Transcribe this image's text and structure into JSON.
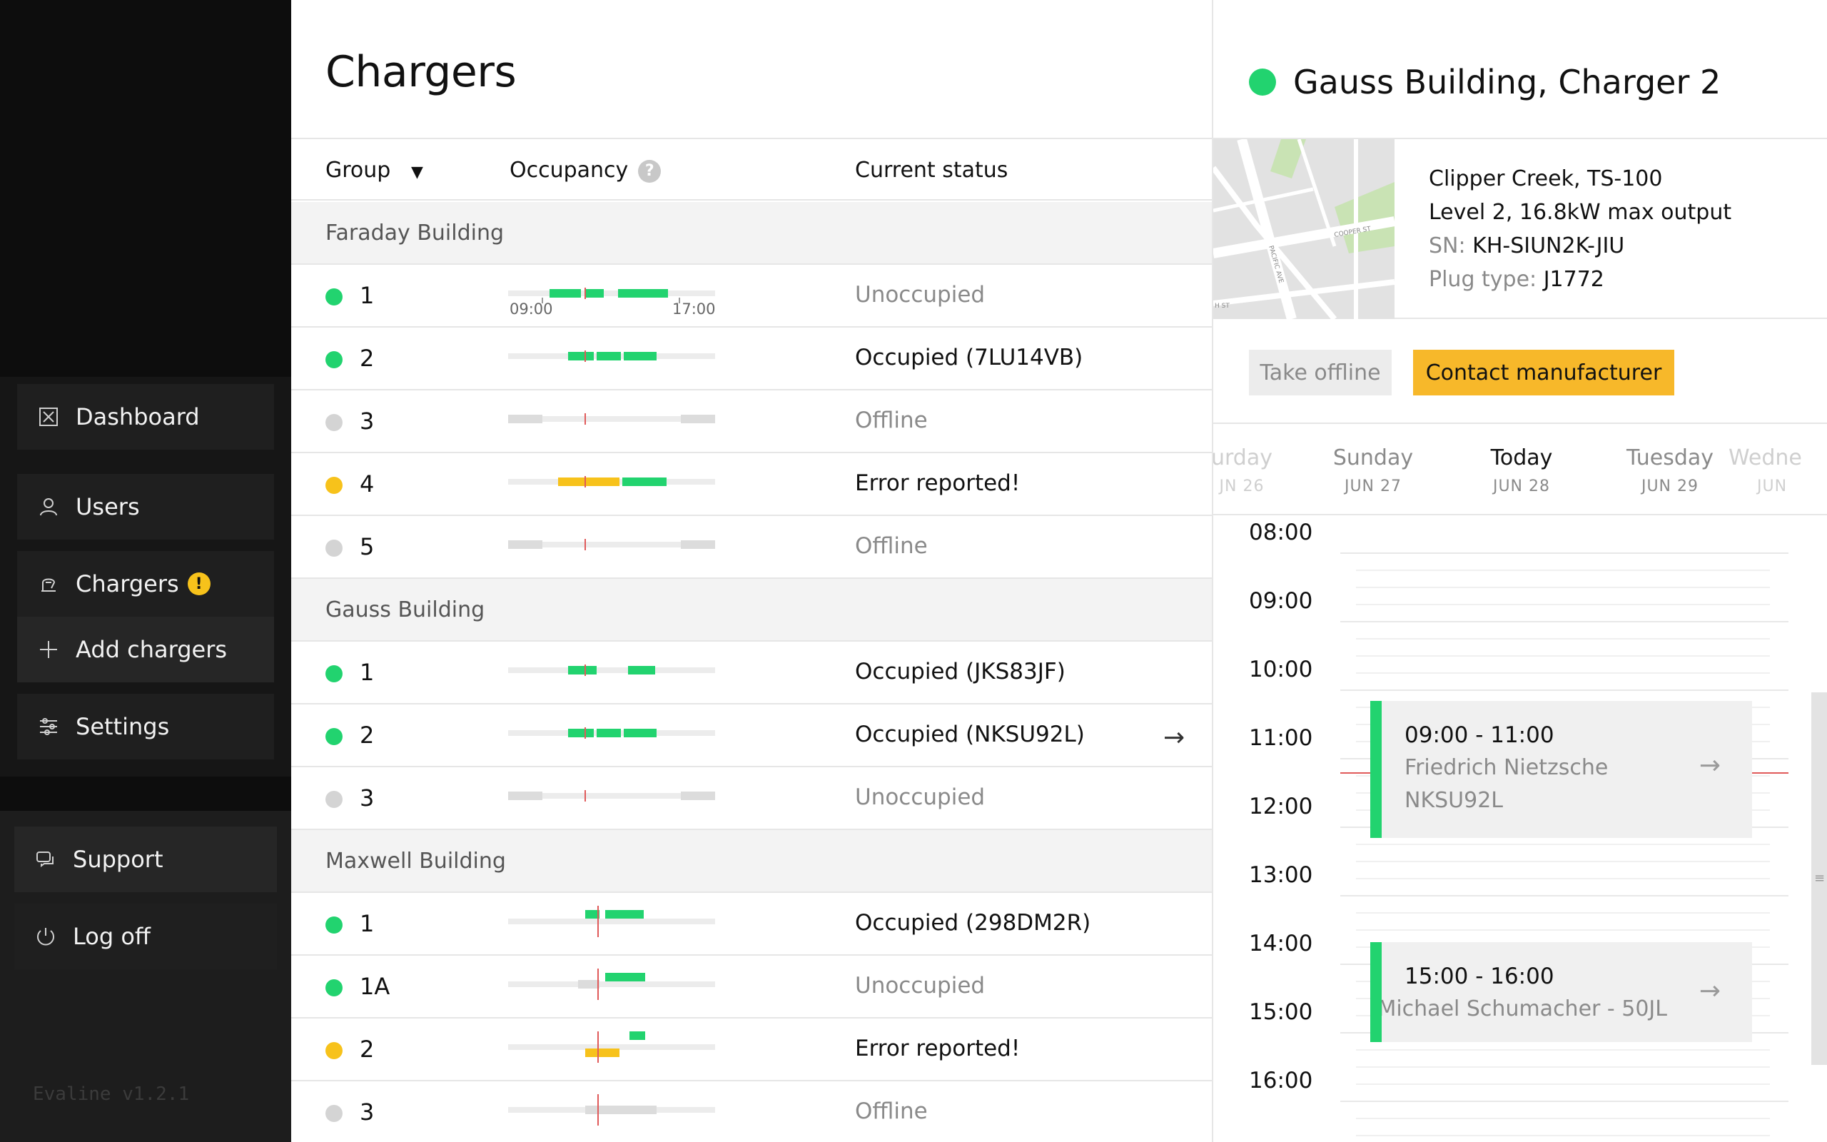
{
  "sidebar": {
    "items": [
      {
        "label": "Dashboard",
        "icon": "dashboard-icon"
      },
      {
        "label": "Users",
        "icon": "user-icon"
      },
      {
        "label": "Chargers",
        "icon": "charger-icon",
        "badge": "!"
      },
      {
        "label": "Add chargers",
        "icon": "plus-icon"
      },
      {
        "label": "Settings",
        "icon": "sliders-icon"
      }
    ],
    "support_label": "Support",
    "logoff_label": "Log off",
    "version": "Evaline v1.2.1"
  },
  "list": {
    "title": "Chargers",
    "headers": {
      "group": "Group",
      "group_caret": "▼",
      "occupancy": "Occupancy",
      "occupancy_help": "?",
      "status": "Current status"
    },
    "time_labels": {
      "start": "09:00",
      "end": "17:00"
    },
    "groups": [
      {
        "name": "Faraday Building",
        "chargers": [
          {
            "id": "1",
            "state": "green",
            "status": "Unoccupied",
            "status_style": "muted"
          },
          {
            "id": "2",
            "state": "green",
            "status": "Occupied (7LU14VB)",
            "status_style": "dark"
          },
          {
            "id": "3",
            "state": "grey",
            "status": "Offline",
            "status_style": "muted"
          },
          {
            "id": "4",
            "state": "yellow",
            "status": "Error reported!",
            "status_style": "dark"
          },
          {
            "id": "5",
            "state": "grey",
            "status": "Offline",
            "status_style": "muted"
          }
        ]
      },
      {
        "name": "Gauss Building",
        "chargers": [
          {
            "id": "1",
            "state": "green",
            "status": "Occupied (JKS83JF)",
            "status_style": "dark"
          },
          {
            "id": "2",
            "state": "green",
            "status": "Occupied (NKSU92L)",
            "status_style": "dark",
            "selected_arrow": "→"
          },
          {
            "id": "3",
            "state": "grey",
            "status": "Unoccupied",
            "status_style": "muted"
          }
        ]
      },
      {
        "name": "Maxwell Building",
        "chargers": [
          {
            "id": "1",
            "state": "green",
            "status": "Occupied (298DM2R)",
            "status_style": "dark"
          },
          {
            "id": "1A",
            "state": "green",
            "status": "Unoccupied",
            "status_style": "muted"
          },
          {
            "id": "2",
            "state": "yellow",
            "status": "Error reported!",
            "status_style": "dark"
          },
          {
            "id": "3",
            "state": "grey",
            "status": "Offline",
            "status_style": "muted"
          }
        ]
      }
    ]
  },
  "detail": {
    "title": "Gauss Building, Charger 2",
    "model": "Clipper Creek, TS-100",
    "output": "Level 2, 16.8kW max output",
    "sn_label": "SN:",
    "sn_value": "KH-SIUN2K-JIU",
    "plug_label": "Plug type:",
    "plug_value": "J1772",
    "map_labels": {
      "street1": "COOPER ST",
      "street2": "PACIFIC AVE",
      "street3": "H ST"
    },
    "take_offline_label": "Take offline",
    "contact_label": "Contact manufacturer",
    "days": [
      {
        "name": "urday",
        "date": "JN 26"
      },
      {
        "name": "Sunday",
        "date": "JUN 27"
      },
      {
        "name": "Today",
        "date": "JUN 28"
      },
      {
        "name": "Tuesday",
        "date": "JUN 29"
      },
      {
        "name": "Wedne",
        "date": "JUN"
      }
    ],
    "hours": [
      "08:00",
      "09:00",
      "10:00",
      "11:00",
      "12:00",
      "13:00",
      "14:00",
      "15:00",
      "16:00"
    ],
    "events": [
      {
        "time": "09:00 - 11:00",
        "name": "Friedrich Nietzsche",
        "plate": "NKSU92L",
        "arrow": "→"
      },
      {
        "time": "15:00 - 16:00",
        "name": "Michael Schumacher - 50JL",
        "arrow": "→"
      }
    ],
    "scroll_grip": "≡"
  },
  "colors": {
    "green": "#22d36f",
    "yellow": "#f7c21b",
    "grey": "#d4d4d4",
    "orange": "#f7b82a",
    "now_line": "#e05a5a"
  }
}
